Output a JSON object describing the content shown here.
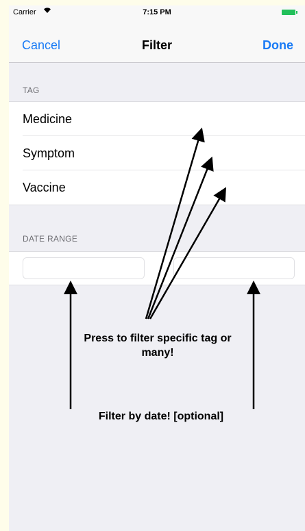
{
  "status_bar": {
    "carrier": "Carrier",
    "wifi_icon": "὏6",
    "time": "7:15 PM",
    "battery_bolt": "⚡"
  },
  "nav": {
    "cancel": "Cancel",
    "title": "Filter",
    "done": "Done"
  },
  "tag_section": {
    "header": "TAG",
    "items": [
      {
        "label": "Medicine"
      },
      {
        "label": "Symptom"
      },
      {
        "label": "Vaccine"
      }
    ]
  },
  "date_section": {
    "header": "DATE RANGE",
    "start_value": "",
    "end_value": ""
  },
  "annotations": {
    "tags_note": "Press to filter specific tag or many!",
    "date_note": "Filter by date! [optional]"
  },
  "colors": {
    "accent": "#1a7bf5",
    "background": "#efeff4",
    "outer_background": "#fefdea",
    "battery": "#22c05a"
  }
}
